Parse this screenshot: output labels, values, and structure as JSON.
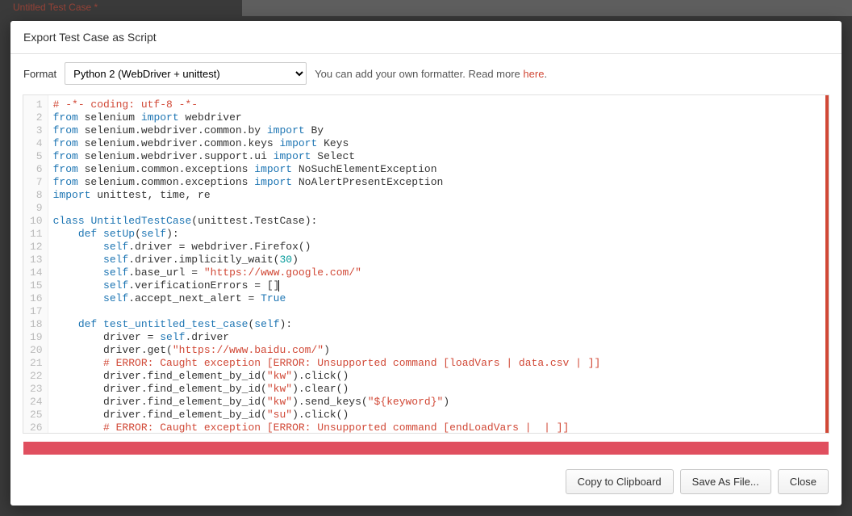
{
  "background": {
    "leftText": "Untitled Test Case *"
  },
  "modal": {
    "title": "Export Test Case as Script",
    "formatLabel": "Format",
    "formatSelected": "Python 2 (WebDriver + unittest)",
    "formatOptions": [
      "Python 2 (WebDriver + unittest)"
    ],
    "hintPrefix": "You can add your own formatter. Read more ",
    "hintLink": "here",
    "hintSuffix": "."
  },
  "code": {
    "lines": [
      {
        "n": 1,
        "tokens": [
          [
            "cmt",
            "# -*- coding: utf-8 -*-"
          ]
        ]
      },
      {
        "n": 2,
        "tokens": [
          [
            "kw",
            "from"
          ],
          [
            "txt",
            " selenium "
          ],
          [
            "kw",
            "import"
          ],
          [
            "txt",
            " webdriver"
          ]
        ]
      },
      {
        "n": 3,
        "tokens": [
          [
            "kw",
            "from"
          ],
          [
            "txt",
            " selenium.webdriver.common.by "
          ],
          [
            "kw",
            "import"
          ],
          [
            "txt",
            " By"
          ]
        ]
      },
      {
        "n": 4,
        "tokens": [
          [
            "kw",
            "from"
          ],
          [
            "txt",
            " selenium.webdriver.common.keys "
          ],
          [
            "kw",
            "import"
          ],
          [
            "txt",
            " Keys"
          ]
        ]
      },
      {
        "n": 5,
        "tokens": [
          [
            "kw",
            "from"
          ],
          [
            "txt",
            " selenium.webdriver.support.ui "
          ],
          [
            "kw",
            "import"
          ],
          [
            "txt",
            " Select"
          ]
        ]
      },
      {
        "n": 6,
        "tokens": [
          [
            "kw",
            "from"
          ],
          [
            "txt",
            " selenium.common.exceptions "
          ],
          [
            "kw",
            "import"
          ],
          [
            "txt",
            " NoSuchElementException"
          ]
        ]
      },
      {
        "n": 7,
        "tokens": [
          [
            "kw",
            "from"
          ],
          [
            "txt",
            " selenium.common.exceptions "
          ],
          [
            "kw",
            "import"
          ],
          [
            "txt",
            " NoAlertPresentException"
          ]
        ]
      },
      {
        "n": 8,
        "tokens": [
          [
            "kw",
            "import"
          ],
          [
            "txt",
            " unittest, time, re"
          ]
        ]
      },
      {
        "n": 9,
        "tokens": [
          [
            "txt",
            ""
          ]
        ]
      },
      {
        "n": 10,
        "tokens": [
          [
            "kw",
            "class"
          ],
          [
            "txt",
            " "
          ],
          [
            "name-cls",
            "UntitledTestCase"
          ],
          [
            "txt",
            "(unittest.TestCase):"
          ]
        ]
      },
      {
        "n": 11,
        "tokens": [
          [
            "txt",
            "    "
          ],
          [
            "kw",
            "def"
          ],
          [
            "txt",
            " "
          ],
          [
            "name-def",
            "setUp"
          ],
          [
            "txt",
            "("
          ],
          [
            "self",
            "self"
          ],
          [
            "txt",
            "):"
          ]
        ]
      },
      {
        "n": 12,
        "tokens": [
          [
            "txt",
            "        "
          ],
          [
            "self",
            "self"
          ],
          [
            "txt",
            ".driver = webdriver.Firefox()"
          ]
        ]
      },
      {
        "n": 13,
        "tokens": [
          [
            "txt",
            "        "
          ],
          [
            "self",
            "self"
          ],
          [
            "txt",
            ".driver.implicitly_wait("
          ],
          [
            "num",
            "30"
          ],
          [
            "txt",
            ")"
          ]
        ]
      },
      {
        "n": 14,
        "tokens": [
          [
            "txt",
            "        "
          ],
          [
            "self",
            "self"
          ],
          [
            "txt",
            ".base_url = "
          ],
          [
            "str",
            "\"https://www.google.com/\""
          ]
        ]
      },
      {
        "n": 15,
        "tokens": [
          [
            "txt",
            "        "
          ],
          [
            "self",
            "self"
          ],
          [
            "txt",
            ".verificationErrors = []"
          ],
          [
            "cursor",
            ""
          ]
        ]
      },
      {
        "n": 16,
        "tokens": [
          [
            "txt",
            "        "
          ],
          [
            "self",
            "self"
          ],
          [
            "txt",
            ".accept_next_alert = "
          ],
          [
            "bi",
            "True"
          ]
        ]
      },
      {
        "n": 17,
        "tokens": [
          [
            "txt",
            ""
          ]
        ]
      },
      {
        "n": 18,
        "tokens": [
          [
            "txt",
            "    "
          ],
          [
            "kw",
            "def"
          ],
          [
            "txt",
            " "
          ],
          [
            "name-def",
            "test_untitled_test_case"
          ],
          [
            "txt",
            "("
          ],
          [
            "self",
            "self"
          ],
          [
            "txt",
            "):"
          ]
        ]
      },
      {
        "n": 19,
        "tokens": [
          [
            "txt",
            "        driver = "
          ],
          [
            "self",
            "self"
          ],
          [
            "txt",
            ".driver"
          ]
        ]
      },
      {
        "n": 20,
        "tokens": [
          [
            "txt",
            "        driver.get("
          ],
          [
            "str",
            "\"https://www.baidu.com/\""
          ],
          [
            "txt",
            ")"
          ]
        ]
      },
      {
        "n": 21,
        "tokens": [
          [
            "txt",
            "        "
          ],
          [
            "err",
            "# ERROR: Caught exception [ERROR: Unsupported command [loadVars | data.csv | ]]"
          ]
        ]
      },
      {
        "n": 22,
        "tokens": [
          [
            "txt",
            "        driver.find_element_by_id("
          ],
          [
            "str",
            "\"kw\""
          ],
          [
            "txt",
            ").click()"
          ]
        ]
      },
      {
        "n": 23,
        "tokens": [
          [
            "txt",
            "        driver.find_element_by_id("
          ],
          [
            "str",
            "\"kw\""
          ],
          [
            "txt",
            ").clear()"
          ]
        ]
      },
      {
        "n": 24,
        "tokens": [
          [
            "txt",
            "        driver.find_element_by_id("
          ],
          [
            "str",
            "\"kw\""
          ],
          [
            "txt",
            ").send_keys("
          ],
          [
            "str",
            "\"${keyword}\""
          ],
          [
            "txt",
            ")"
          ]
        ]
      },
      {
        "n": 25,
        "tokens": [
          [
            "txt",
            "        driver.find_element_by_id("
          ],
          [
            "str",
            "\"su\""
          ],
          [
            "txt",
            ").click()"
          ]
        ]
      },
      {
        "n": 26,
        "tokens": [
          [
            "txt",
            "        "
          ],
          [
            "err",
            "# ERROR: Caught exception [ERROR: Unsupported command [endLoadVars |  | ]]"
          ]
        ]
      }
    ]
  },
  "footer": {
    "copy": "Copy to Clipboard",
    "save": "Save As File...",
    "close": "Close"
  }
}
